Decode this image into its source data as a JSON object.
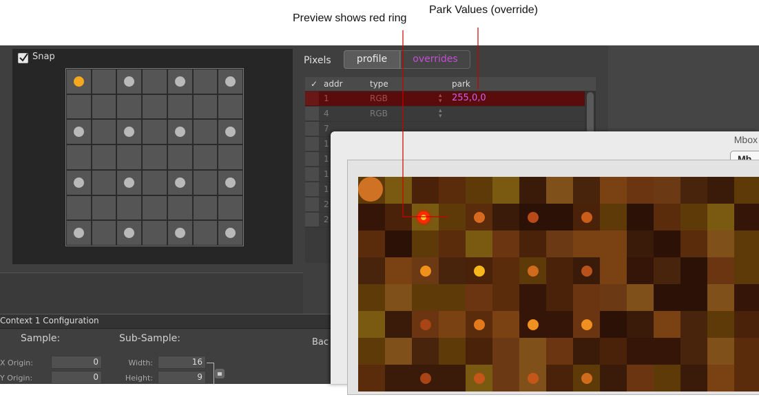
{
  "callouts": {
    "preview": "Preview shows red ring",
    "park": "Park Values (override)"
  },
  "snap": {
    "label": "Snap",
    "checked": true
  },
  "pixels": {
    "title": "Pixels",
    "tabs": [
      {
        "label": "profile"
      },
      {
        "label": "overrides"
      }
    ],
    "columns": {
      "check": "✓",
      "addr": "addr",
      "type": "type",
      "park": "park"
    },
    "rows": [
      {
        "addr": "1",
        "type": "RGB",
        "park": "255,0,0",
        "highlight": true
      },
      {
        "addr": "4",
        "type": "RGB",
        "park": ""
      },
      {
        "addr": "7",
        "type": "",
        "park": ""
      },
      {
        "addr": "1",
        "type": "",
        "park": ""
      },
      {
        "addr": "1",
        "type": "",
        "park": ""
      },
      {
        "addr": "1",
        "type": "",
        "park": ""
      },
      {
        "addr": "1",
        "type": "",
        "park": ""
      },
      {
        "addr": "2",
        "type": "",
        "park": ""
      },
      {
        "addr": "2",
        "type": "",
        "park": ""
      }
    ]
  },
  "context": {
    "title": "Context 1 Configuration",
    "sample": "Sample:",
    "subsample": "Sub-Sample:",
    "x_origin_label": "X Origin:",
    "x_origin": "0",
    "y_origin_label": "Y Origin:",
    "y_origin": "0",
    "width_label": "Width:",
    "width": "16",
    "height_label": "Height:",
    "height": "9",
    "bac": "Bac"
  },
  "mbox": {
    "title": "Mbox",
    "button": "Mb"
  },
  "colors": {
    "accent_purple": "#c44fd6",
    "selected_dot": "#f3a81d",
    "highlight_row": "#5a0c0c"
  }
}
